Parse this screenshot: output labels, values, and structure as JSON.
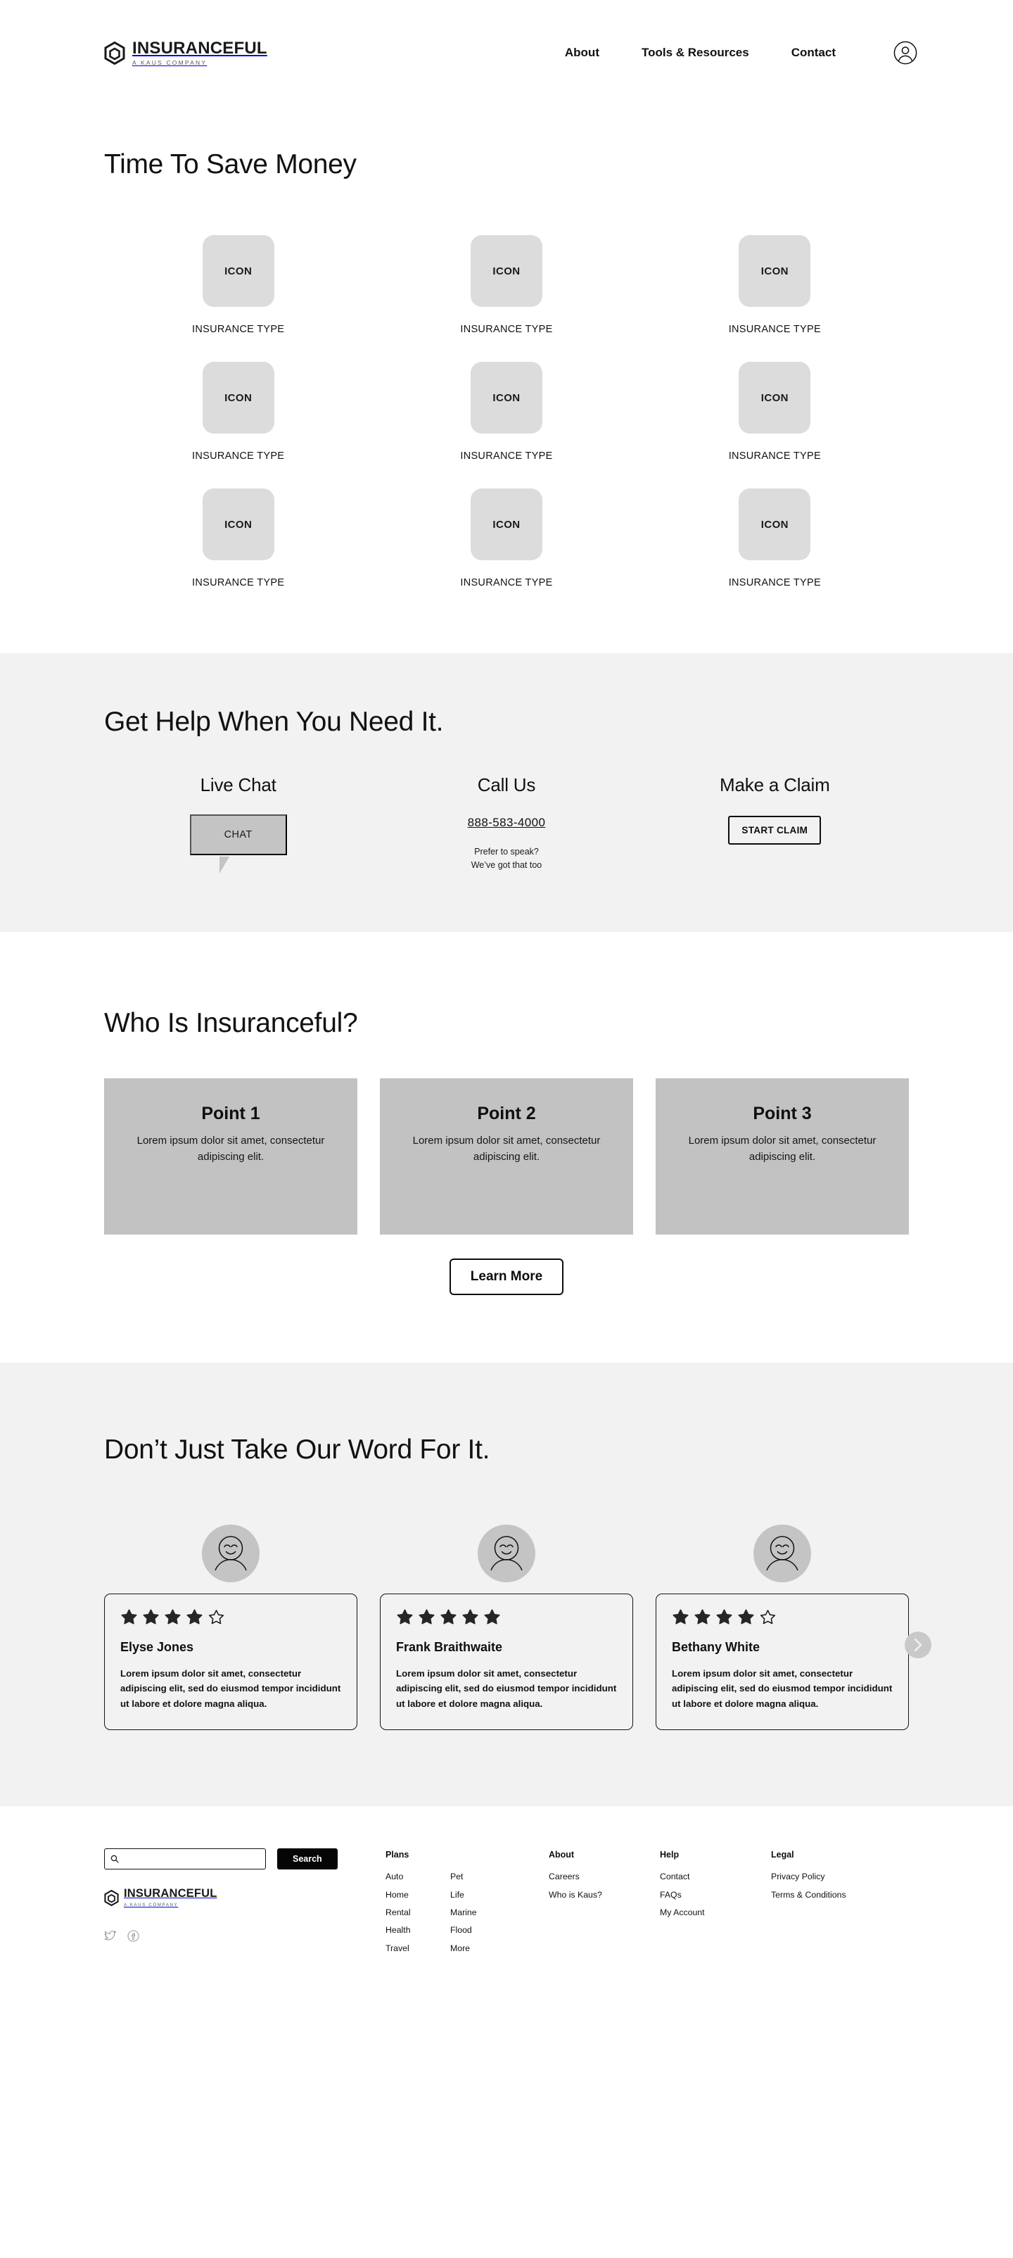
{
  "header": {
    "logo": {
      "word": "INSURANCEFUL",
      "sub": "A KAUS COMPANY"
    },
    "nav": [
      {
        "label": "About"
      },
      {
        "label": "Tools & Resources"
      },
      {
        "label": "Contact"
      }
    ],
    "account_icon": "user-account-icon"
  },
  "hero": {
    "title": "Time To Save Money",
    "tiles": [
      {
        "icon_label": "ICON",
        "caption": "INSURANCE TYPE"
      },
      {
        "icon_label": "ICON",
        "caption": "INSURANCE TYPE"
      },
      {
        "icon_label": "ICON",
        "caption": "INSURANCE TYPE"
      },
      {
        "icon_label": "ICON",
        "caption": "INSURANCE TYPE"
      },
      {
        "icon_label": "ICON",
        "caption": "INSURANCE TYPE"
      },
      {
        "icon_label": "ICON",
        "caption": "INSURANCE TYPE"
      },
      {
        "icon_label": "ICON",
        "caption": "INSURANCE TYPE"
      },
      {
        "icon_label": "ICON",
        "caption": "INSURANCE TYPE"
      },
      {
        "icon_label": "ICON",
        "caption": "INSURANCE TYPE"
      }
    ]
  },
  "help": {
    "title": "Get Help When You Need It.",
    "chat": {
      "heading": "Live Chat",
      "bubble_label": "CHAT"
    },
    "call": {
      "heading": "Call Us",
      "phone": "888-583-4000",
      "note_line1": "Prefer to speak?",
      "note_line2": "We’ve got that too"
    },
    "claim": {
      "heading": "Make a Claim",
      "button_label": "START CLAIM"
    }
  },
  "who": {
    "title": "Who Is Insuranceful?",
    "points": [
      {
        "title": "Point 1",
        "body": "Lorem ipsum dolor sit amet, consectetur adipiscing elit."
      },
      {
        "title": "Point 2",
        "body": "Lorem ipsum dolor sit amet, consectetur adipiscing elit."
      },
      {
        "title": "Point 3",
        "body": "Lorem ipsum dolor sit amet, consectetur adipiscing elit."
      }
    ],
    "learn_more_label": "Learn More"
  },
  "testimonials": {
    "title": "Don’t Just Take Our Word For It.",
    "items": [
      {
        "name": "Elyse Jones",
        "rating": 4,
        "max_rating": 5,
        "body": "Lorem ipsum dolor sit amet, consectetur adipiscing elit, sed do eiusmod tempor incididunt ut labore et dolore magna aliqua.",
        "avatar_icon": "smiley-avatar-icon"
      },
      {
        "name": "Frank Braithwaite",
        "rating": 5,
        "max_rating": 5,
        "body": "Lorem ipsum dolor sit amet, consectetur adipiscing elit, sed do eiusmod tempor incididunt ut labore et dolore magna aliqua.",
        "avatar_icon": "smiley-avatar-icon"
      },
      {
        "name": "Bethany White",
        "rating": 4,
        "max_rating": 5,
        "body": "Lorem ipsum dolor sit amet, consectetur adipiscing elit, sed do eiusmod tempor incididunt ut labore et dolore magna aliqua.",
        "avatar_icon": "smiley-avatar-icon"
      }
    ],
    "next_icon": "chevron-right-icon"
  },
  "footer": {
    "search": {
      "placeholder": "",
      "value": "",
      "icon": "search-icon",
      "button_label": "Search"
    },
    "logo": {
      "word": "INSURANCEFUL",
      "sub": "A KAUS COMPANY"
    },
    "socials": [
      {
        "icon": "twitter-icon"
      },
      {
        "icon": "facebook-icon"
      }
    ],
    "columns": [
      {
        "heading": "Plans",
        "sub_a": [
          "Auto",
          "Home",
          "Rental",
          "Health",
          "Travel"
        ],
        "sub_b": [
          "Pet",
          "Life",
          "Marine",
          "Flood",
          "More"
        ]
      },
      {
        "heading": "About",
        "links": [
          "Careers",
          "Who is Kaus?"
        ]
      },
      {
        "heading": "Help",
        "links": [
          "Contact",
          "FAQs",
          "My Account"
        ]
      },
      {
        "heading": "Legal",
        "links": [
          "Privacy Policy",
          "Terms & Conditions"
        ]
      }
    ]
  },
  "colors": {
    "page_bg": "#ffffff",
    "band_bg": "#f2f2f2",
    "tile_gray": "#dcdcdc",
    "card_gray": "#c2c2c2",
    "ink": "#111111",
    "button_black": "#050505"
  }
}
